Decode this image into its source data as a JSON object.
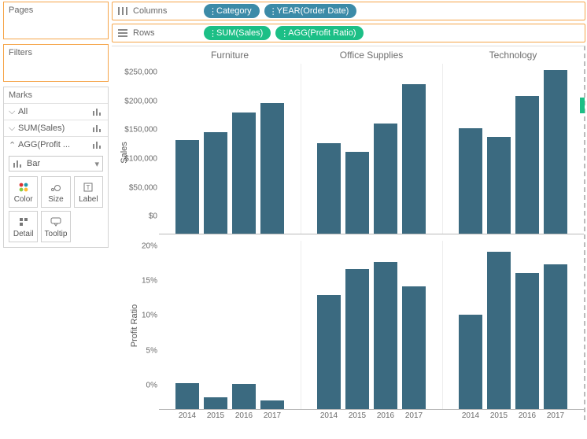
{
  "left": {
    "pages_title": "Pages",
    "filters_title": "Filters",
    "marks_title": "Marks",
    "marks_rows": {
      "all": "All",
      "sum": "SUM(Sales)",
      "agg": "AGG(Profit ..."
    },
    "mark_type": "Bar",
    "mark_buttons": {
      "color": "Color",
      "size": "Size",
      "label": "Label",
      "detail": "Detail",
      "tooltip": "Tooltip"
    }
  },
  "shelves": {
    "columns_label": "Columns",
    "rows_label": "Rows",
    "columns": {
      "p1": "Category",
      "p2": "YEAR(Order Date)"
    },
    "rows": {
      "p1": "SUM(Sales)",
      "p2": "AGG(Profit Ratio)"
    }
  },
  "chart": {
    "categories": {
      "c0": "Furniture",
      "c1": "Office Supplies",
      "c2": "Technology"
    },
    "years": {
      "y0": "2014",
      "y1": "2015",
      "y2": "2016",
      "y3": "2017"
    },
    "ylabels": {
      "sales": "Sales",
      "ratio": "Profit Ratio"
    },
    "sales_ticks": {
      "t0": "$0",
      "t50": "$50,000",
      "t100": "$100,000",
      "t150": "$150,000",
      "t200": "$200,000",
      "t250": "$250,000"
    },
    "ratio_ticks": {
      "t0": "0%",
      "t5": "5%",
      "t10": "10%",
      "t15": "15%",
      "t20": "20%"
    }
  },
  "chart_data": [
    {
      "type": "bar",
      "title": "",
      "xlabel": "",
      "ylabel": "Sales",
      "ylim": [
        0,
        280000
      ],
      "facet_by": "Category",
      "x": [
        "2014",
        "2015",
        "2016",
        "2017"
      ],
      "series": [
        {
          "name": "Furniture",
          "values": [
            155000,
            168000,
            200000,
            215000
          ]
        },
        {
          "name": "Office Supplies",
          "values": [
            150000,
            136000,
            182000,
            247000
          ]
        },
        {
          "name": "Technology",
          "values": [
            174000,
            160000,
            227000,
            270000
          ]
        }
      ]
    },
    {
      "type": "bar",
      "title": "",
      "xlabel": "YEAR(Order Date)",
      "ylabel": "Profit Ratio",
      "ylim": [
        0,
        0.22
      ],
      "facet_by": "Category",
      "x": [
        "2014",
        "2015",
        "2016",
        "2017"
      ],
      "series": [
        {
          "name": "Furniture",
          "values": [
            0.035,
            0.016,
            0.034,
            0.012
          ]
        },
        {
          "name": "Office Supplies",
          "values": [
            0.149,
            0.183,
            0.192,
            0.161
          ]
        },
        {
          "name": "Technology",
          "values": [
            0.124,
            0.206,
            0.178,
            0.189
          ]
        }
      ]
    }
  ]
}
